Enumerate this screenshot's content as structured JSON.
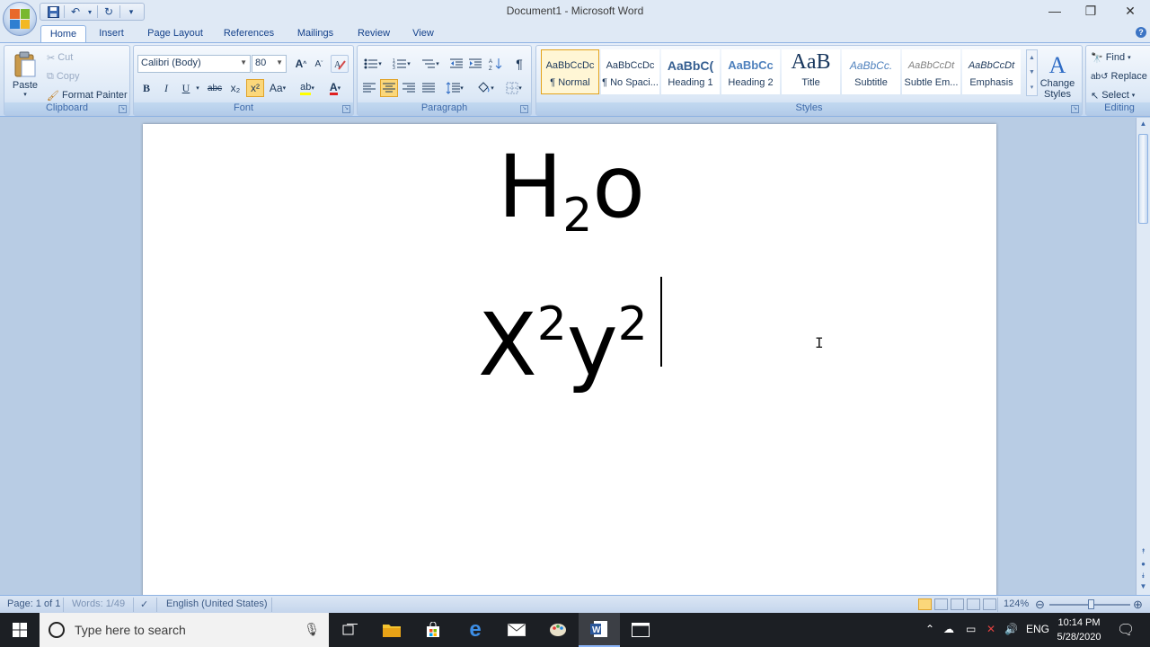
{
  "window": {
    "title": "Document1 - Microsoft Word",
    "controls": {
      "minimize": "—",
      "restore": "❐",
      "close": "✕"
    }
  },
  "quick_access": {
    "save": "💾",
    "undo": "↶",
    "redo": "↻",
    "customize": "▾"
  },
  "tabs": [
    "Home",
    "Insert",
    "Page Layout",
    "References",
    "Mailings",
    "Review",
    "View"
  ],
  "active_tab": "Home",
  "clipboard": {
    "paste": "Paste",
    "cut": "Cut",
    "copy": "Copy",
    "format_painter": "Format Painter",
    "label": "Clipboard"
  },
  "font": {
    "family": "Calibri (Body)",
    "size": "80",
    "label": "Font",
    "bold": "B",
    "italic": "I",
    "underline": "U",
    "strikethrough": "abc",
    "subscript": "x₂",
    "superscript": "x²",
    "change_case": "Aa",
    "grow": "A",
    "shrink": "A",
    "font_color": "A"
  },
  "paragraph": {
    "label": "Paragraph",
    "pilcrow": "¶"
  },
  "styles": {
    "label": "Styles",
    "items": [
      {
        "sample": "AaBbCcDc",
        "name": "¶ Normal"
      },
      {
        "sample": "AaBbCcDc",
        "name": "¶ No Spaci..."
      },
      {
        "sample": "AaBbC(",
        "name": "Heading 1"
      },
      {
        "sample": "AaBbCc",
        "name": "Heading 2"
      },
      {
        "sample": "AaB",
        "name": "Title"
      },
      {
        "sample": "AaBbCc.",
        "name": "Subtitle"
      },
      {
        "sample": "AaBbCcDt",
        "name": "Subtle Em..."
      },
      {
        "sample": "AaBbCcDt",
        "name": "Emphasis"
      }
    ],
    "change_styles": "Change Styles",
    "change_styles_icon": "A"
  },
  "editing": {
    "find": "Find",
    "replace": "Replace",
    "select": "Select",
    "label": "Editing"
  },
  "document": {
    "line1": {
      "base1": "H",
      "sub": "2",
      "base2": "o"
    },
    "line2": {
      "base1": "X",
      "sup1": "2",
      "base2": "y",
      "sup2": "2"
    }
  },
  "status": {
    "page": "Page: 1 of 1",
    "words": "Words: 1/49",
    "language": "English (United States)",
    "zoom": "124%"
  },
  "taskbar": {
    "search_placeholder": "Type here to search",
    "language": "ENG",
    "time": "10:14 PM",
    "date": "5/28/2020"
  }
}
